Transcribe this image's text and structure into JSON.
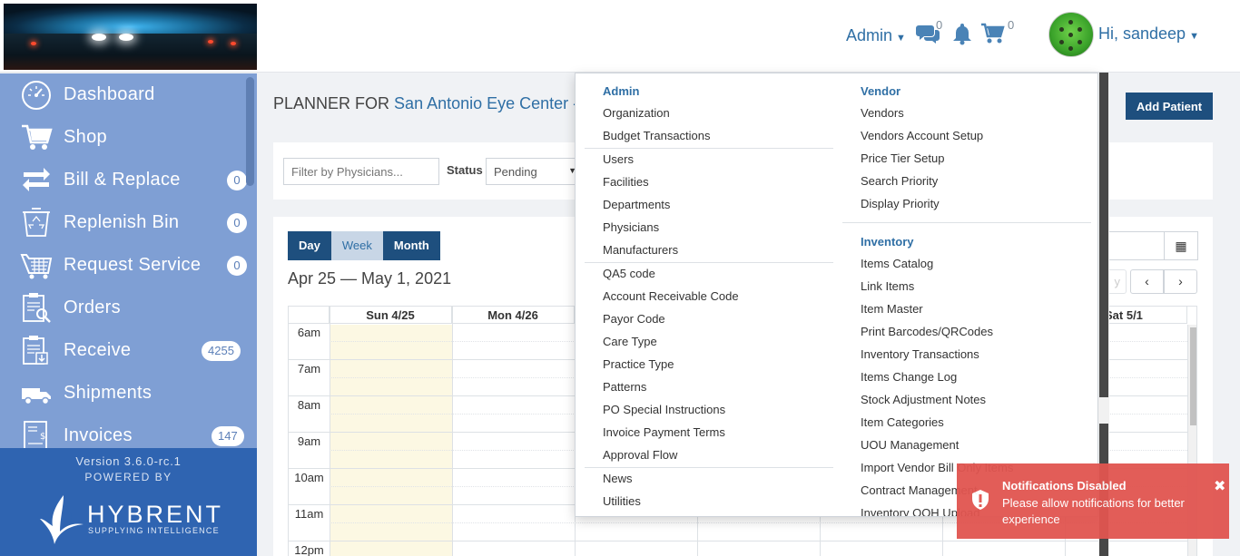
{
  "header": {
    "admin_menu": "Admin",
    "chat_count": "0",
    "cart_count": "0",
    "user_greeting": "Hi, sandeep"
  },
  "sidebar": {
    "items": [
      {
        "label": "Dashboard",
        "icon": "speedometer-icon",
        "count": ""
      },
      {
        "label": "Shop",
        "icon": "cart-icon",
        "count": ""
      },
      {
        "label": "Bill & Replace",
        "icon": "exchange-icon",
        "count": "0"
      },
      {
        "label": "Replenish Bin",
        "icon": "recycle-bin-icon",
        "count": "0"
      },
      {
        "label": "Request Service",
        "icon": "service-basket-icon",
        "count": "0"
      },
      {
        "label": "Orders",
        "icon": "clipboard-search-icon",
        "count": ""
      },
      {
        "label": "Receive",
        "icon": "clipboard-download-icon",
        "count": "4255"
      },
      {
        "label": "Shipments",
        "icon": "truck-icon",
        "count": ""
      },
      {
        "label": "Invoices",
        "icon": "invoice-icon",
        "count": "147"
      }
    ],
    "version": "Version 3.6.0-rc.1",
    "powered_by": "POWERED BY",
    "brand": "HYBRENT",
    "brand_tagline": "SUPPLYING INTELLIGENCE"
  },
  "main": {
    "title_prefix": "PLANNER FOR",
    "facility": "San Antonio Eye Center -",
    "add_patient": "Add Patient",
    "filter_placeholder": "Filter by Physicians...",
    "status_label": "Status",
    "status_value": "Pending",
    "views": [
      "Day",
      "Week",
      "Month"
    ],
    "active_view": "Week",
    "date_range": "Apr 25 — May 1, 2021",
    "day_headers": [
      "Sun 4/25",
      "Mon 4/26",
      "",
      "",
      "",
      "",
      "Sat 5/1"
    ],
    "times": [
      "6am",
      "7am",
      "8am",
      "9am",
      "10am",
      "11am",
      "12pm"
    ]
  },
  "dropdown": {
    "admin_header": "Admin",
    "admin_group1": [
      "Organization",
      "Budget Transactions"
    ],
    "admin_group2": [
      "Users",
      "Facilities",
      "Departments",
      "Physicians",
      "Manufacturers"
    ],
    "admin_group3": [
      "QA5 code",
      "Account Receivable Code",
      "Payor Code",
      "Care Type",
      "Practice Type",
      "Patterns",
      "PO Special Instructions",
      "Invoice Payment Terms",
      "Approval Flow"
    ],
    "admin_group4": [
      "News",
      "Utilities"
    ],
    "vendor_header": "Vendor",
    "vendor_items": [
      "Vendors",
      "Vendors Account Setup",
      "Price Tier Setup",
      "Search Priority",
      "Display Priority"
    ],
    "inventory_header": "Inventory",
    "inventory_items": [
      "Items Catalog",
      "Link Items",
      "Item Master",
      "Print Barcodes/QRCodes",
      "Inventory Transactions",
      "Items Change Log",
      "Stock Adjustment Notes",
      "Item Categories",
      "UOU Management",
      "Import Vendor Bill Only Items",
      "Contract Management",
      "Inventory OOH Upload"
    ]
  },
  "toast": {
    "title": "Notifications Disabled",
    "message": "Please allow notifications for better experience"
  }
}
